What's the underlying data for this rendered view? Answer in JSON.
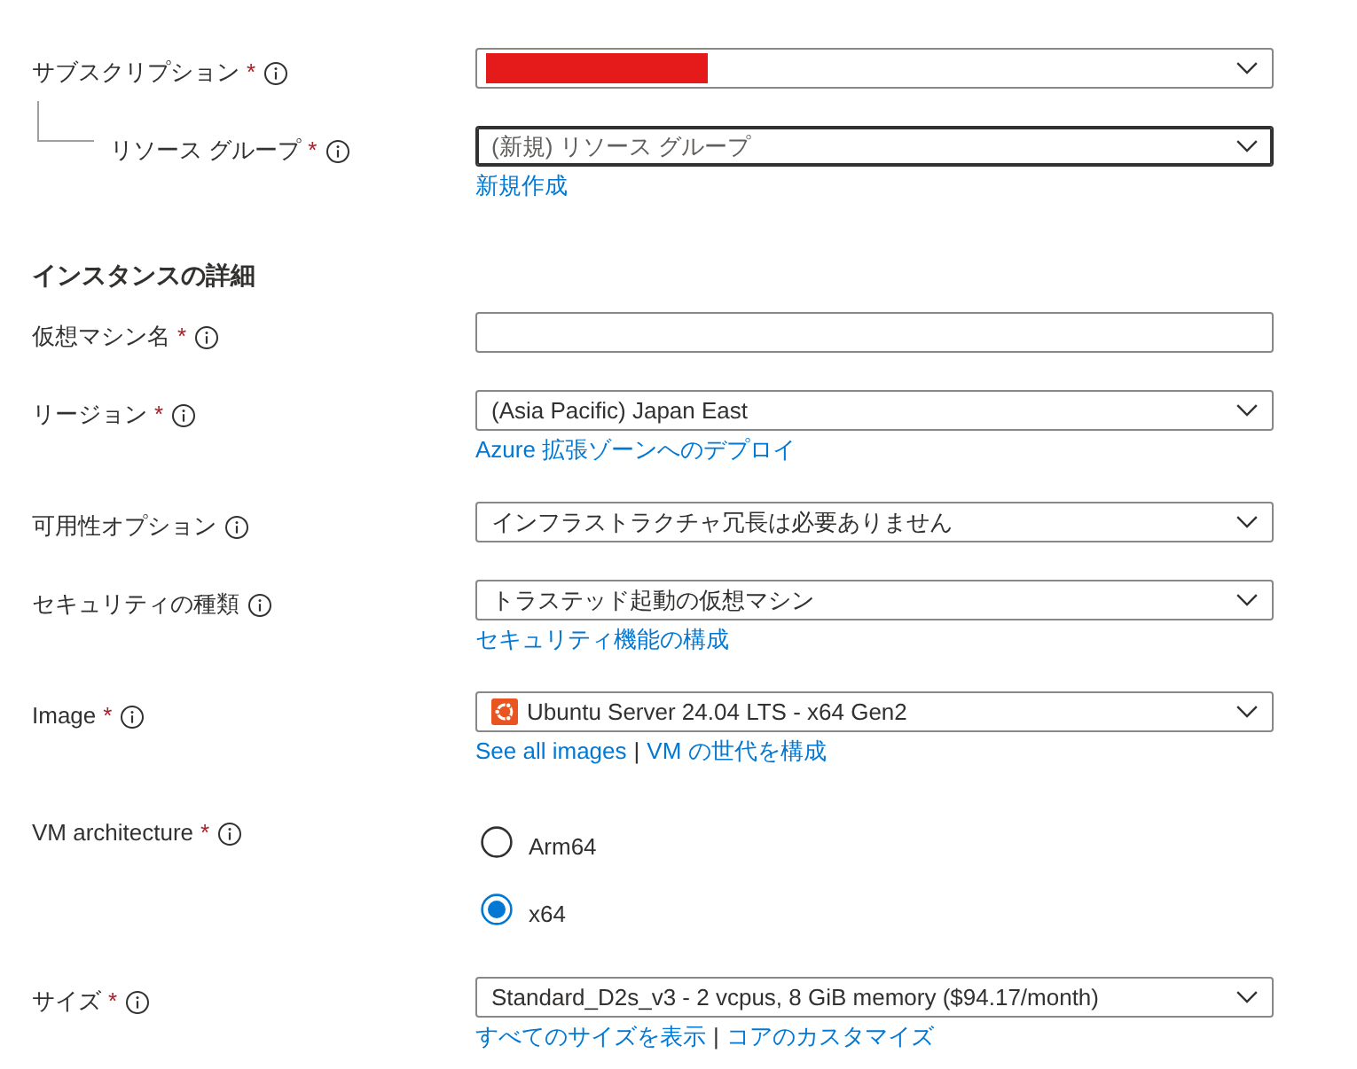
{
  "project": {
    "rows": [
      {
        "label": "サブスクリプション",
        "required_mark": "*",
        "field": {
          "kind": "dropdown",
          "redacted": true,
          "focused": false
        },
        "children": [
          {
            "label": "リソース グループ",
            "required_mark": "*",
            "field": {
              "kind": "dropdown",
              "placeholder": "(新規) リソース グループ",
              "focused": true
            },
            "links": [
              "新規作成"
            ]
          }
        ]
      }
    ]
  },
  "instance_details": {
    "heading": "インスタンスの詳細",
    "rows": [
      {
        "label": "仮想マシン名",
        "required_mark": "*",
        "field": {
          "kind": "text",
          "focused": false
        }
      },
      {
        "label": "リージョン",
        "required_mark": "*",
        "field": {
          "kind": "dropdown",
          "value": "(Asia Pacific) Japan East",
          "focused": false
        },
        "links": [
          "Azure 拡張ゾーンへのデプロイ"
        ]
      },
      {
        "label": "可用性オプション",
        "field": {
          "kind": "dropdown",
          "value": "インフラストラクチャ冗長は必要ありません",
          "focused": false
        }
      },
      {
        "label": "セキュリティの種類",
        "field": {
          "kind": "dropdown",
          "value": "トラステッド起動の仮想マシン",
          "focused": false
        },
        "links": [
          "セキュリティ機能の構成"
        ]
      },
      {
        "label": "Image",
        "required_mark": "*",
        "field": {
          "kind": "dropdown",
          "logo": true,
          "value": "Ubuntu Server 24.04 LTS - x64 Gen2",
          "focused": false
        },
        "links": [
          "See all images",
          "VM の世代を構成"
        ],
        "link_separator": "|"
      },
      {
        "label": "VM architecture",
        "required_mark": "*",
        "field": {
          "kind": "radio",
          "options": [
            {
              "label": "Arm64",
              "selected": false
            },
            {
              "label": "x64",
              "selected": true
            }
          ]
        }
      },
      {
        "label": "サイズ",
        "required_mark": "*",
        "field": {
          "kind": "dropdown",
          "value": "Standard_D2s_v3 - 2 vcpus, 8 GiB memory ($94.17/month)",
          "focused": false
        },
        "links": [
          "すべてのサイズを表示",
          "コアのカスタマイズ"
        ],
        "link_separator": "|"
      }
    ]
  }
}
